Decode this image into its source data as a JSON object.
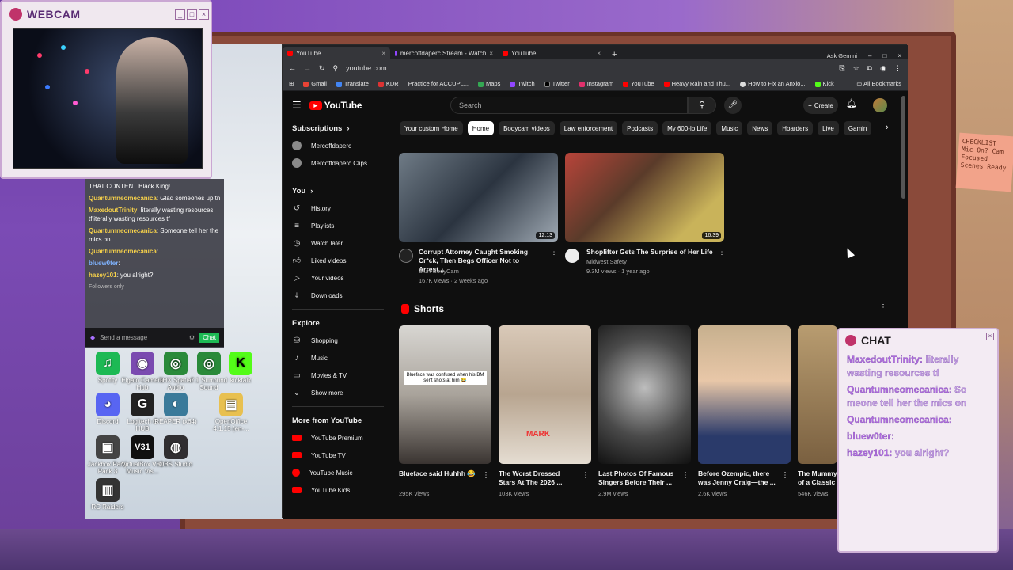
{
  "webcam": {
    "title": "WEBCAM"
  },
  "sticky_note": {
    "text": "CHECKLIST Mic On? Cam Focused Scenes Ready"
  },
  "desktop": {
    "icons": [
      {
        "label": "Spotify",
        "glyph": "♫",
        "color": "#1db954"
      },
      {
        "label": "Elgato Camera Hub",
        "glyph": "◉",
        "color": "#7a4ab0"
      },
      {
        "label": "THX Spatial Audio",
        "glyph": "◎",
        "color": "#2a8a3a"
      },
      {
        "label": "7.1 Surround Sound",
        "glyph": "◎",
        "color": "#2a8a3a"
      },
      {
        "label": "kicktalk",
        "glyph": "K",
        "color": "#53fc18"
      },
      {
        "label": "Discord",
        "glyph": "◕",
        "color": "#5865f2"
      },
      {
        "label": "Logitech G HUB",
        "glyph": "G",
        "color": "#222"
      },
      {
        "label": "REAPER (x64)",
        "glyph": "◐",
        "color": "#3a7a9a"
      },
      {
        "label": "OpenOffice 4.1.15 (en-...",
        "glyph": "▤",
        "color": "#e8c050"
      },
      {
        "label": "Jackbox Party Pack 3",
        "glyph": "▣",
        "color": "#444"
      },
      {
        "label": "VirtualBox V31 Music Vis...",
        "glyph": "V31",
        "color": "#111"
      },
      {
        "label": "OBS Studio",
        "glyph": "◍",
        "color": "#302e31"
      },
      {
        "label": "RC Raiders",
        "glyph": "▥",
        "color": "#333"
      }
    ]
  },
  "twitch_chat": {
    "messages": [
      {
        "user": "",
        "text": "THAT CONTENT Black King!"
      },
      {
        "user": "Quantumneomecanica",
        "text": "Glad someones up tn"
      },
      {
        "user": "MaxedoutTrinity",
        "text": "literally wasting resources tfliterally wasting resources tf"
      },
      {
        "user": "Quantumneomecanica",
        "text": "Someone tell her the mics on"
      },
      {
        "user": "Quantumneomecanica",
        "text": ""
      },
      {
        "user": "bluew0ter",
        "text": ""
      },
      {
        "user": "hazey101",
        "text": "you alright?"
      }
    ],
    "followers_only": "Followers only",
    "input_placeholder": "Send a message",
    "chat_button": "Chat"
  },
  "browser": {
    "tabs": [
      {
        "label": "YouTube",
        "active": true
      },
      {
        "label": "mercoffdaperc Stream - Watch",
        "active": false
      },
      {
        "label": "YouTube",
        "active": false
      }
    ],
    "ask_gemini": "Ask Gemini",
    "url": "youtube.com",
    "bookmarks": [
      "Gmail",
      "Translate",
      "KDR",
      "Practice for ACCUPL...",
      "Maps",
      "Twitch",
      "Twitter",
      "Instagram",
      "YouTube",
      "Heavy Rain and Thu...",
      "How to Fix an Anxio...",
      "Kick"
    ],
    "all_bookmarks": "All Bookmarks"
  },
  "youtube": {
    "logo": "YouTube",
    "search_placeholder": "Search",
    "create": "Create",
    "sidebar": {
      "subscriptions": "Subscriptions",
      "channels": [
        "Mercoffdaperc",
        "Mercoffdaperc Clips"
      ],
      "you": "You",
      "you_items": [
        "History",
        "Playlists",
        "Watch later",
        "Liked videos",
        "Your videos",
        "Downloads"
      ],
      "explore": "Explore",
      "explore_items": [
        "Shopping",
        "Music",
        "Movies & TV",
        "Show more"
      ],
      "more_from": "More from YouTube",
      "more_items": [
        "YouTube Premium",
        "YouTube TV",
        "YouTube Music",
        "YouTube Kids"
      ]
    },
    "chips": [
      "Your custom Home",
      "Home",
      "Bodycam videos",
      "Law enforcement",
      "Podcasts",
      "My 600-lb Life",
      "Music",
      "News",
      "Hoarders",
      "Live",
      "Gamin"
    ],
    "videos": [
      {
        "title": "Corrupt Attorney Caught Smoking Cr*ck, Then Begs Officer Not to Arrest...",
        "channel": "Blurr BodyCam",
        "meta": "167K views · 2 weeks ago",
        "duration": "12:13"
      },
      {
        "title": "Shoplifter Gets The Surprise of Her Life",
        "channel": "Midwest Safety",
        "meta": "9.3M views · 1 year ago",
        "duration": "16:39"
      }
    ],
    "shorts_heading": "Shorts",
    "shorts": [
      {
        "title": "Blueface said Huhhh 😂",
        "views": "295K views",
        "caption": "Blueface was confused when his BM sent shots at him 😂"
      },
      {
        "title": "The Worst Dressed Stars At The 2026 ...",
        "views": "103K views",
        "caption": "MARK"
      },
      {
        "title": "Last Photos Of Famous Singers Before Their ...",
        "views": "2.9M views",
        "caption": ""
      },
      {
        "title": "Before Ozempic, there was Jenny Craig—the ...",
        "views": "2.6K views",
        "caption": ""
      },
      {
        "title": "The Mummy of a Classic",
        "views": "546K views",
        "caption": ""
      }
    ]
  },
  "overlay_chat": {
    "title": "CHAT",
    "messages": [
      {
        "user": "MaxedoutTrinity:",
        "text": "literally wasting resources tf"
      },
      {
        "user": "Quantumneomecanica:",
        "text": "So meone tell her the mics on"
      },
      {
        "user": "Quantumneomecanica:",
        "text": ""
      },
      {
        "user": "bluew0ter:",
        "text": ""
      },
      {
        "user": "hazey101:",
        "text": "you alright?"
      }
    ]
  },
  "colors": {
    "youtube_red": "#ff0000",
    "twitch_user": "#f5d04a",
    "chat_purple": "#b06de0"
  }
}
